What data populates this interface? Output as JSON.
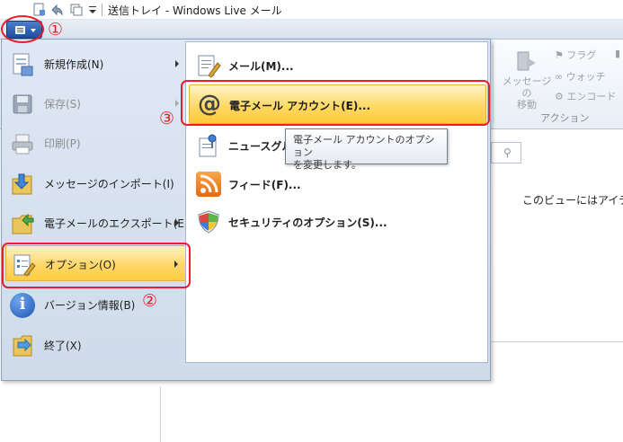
{
  "window": {
    "title": "送信トレイ - Windows Live メール"
  },
  "ribbon": {
    "move_message_label": "メッセージの\n移動",
    "flag_label": "フラグ",
    "watch_label": "ウォッチ",
    "encode_label": "エンコード",
    "group_label": "アクション"
  },
  "content": {
    "empty_message": "このビューにはアイテムが"
  },
  "app_menu": {
    "items": [
      {
        "label": "新規作成(N)",
        "icon": "new-document-icon",
        "has_submenu": true,
        "disabled": false
      },
      {
        "label": "保存(S)",
        "icon": "save-disk-icon",
        "has_submenu": true,
        "disabled": true
      },
      {
        "label": "印刷(P)",
        "icon": "printer-icon",
        "has_submenu": false,
        "disabled": true
      },
      {
        "label": "メッセージのインポート(I)",
        "icon": "import-folder-icon",
        "has_submenu": false,
        "disabled": false
      },
      {
        "label": "電子メールのエクスポート(E)",
        "icon": "export-folder-icon",
        "has_submenu": true,
        "disabled": false
      },
      {
        "label": "オプション(O)",
        "icon": "options-icon",
        "has_submenu": true,
        "disabled": false,
        "selected": true
      },
      {
        "label": "バージョン情報(B)",
        "icon": "info-icon",
        "has_submenu": false,
        "disabled": false
      },
      {
        "label": "終了(X)",
        "icon": "exit-icon",
        "has_submenu": false,
        "disabled": false
      }
    ]
  },
  "options_submenu": {
    "items": [
      {
        "label": "メール(M)...",
        "icon": "mail-options-icon"
      },
      {
        "label": "電子メール アカウント(E)...",
        "icon": "at-sign-icon",
        "selected": true
      },
      {
        "label": "ニュースグルー",
        "icon": "newsgroup-icon"
      },
      {
        "label": "フィード(F)...",
        "icon": "rss-feed-icon"
      },
      {
        "label": "セキュリティのオプション(S)...",
        "icon": "security-shield-icon"
      }
    ]
  },
  "tooltip": {
    "text": "電子メール アカウントのオプション\nを変更します。"
  },
  "annotations": {
    "step1": "①",
    "step2": "②",
    "step3": "③"
  },
  "colors": {
    "annotation_red": "#e8202a",
    "highlight_gold": "#ffd86a",
    "app_button_blue": "#1c4f9f"
  }
}
